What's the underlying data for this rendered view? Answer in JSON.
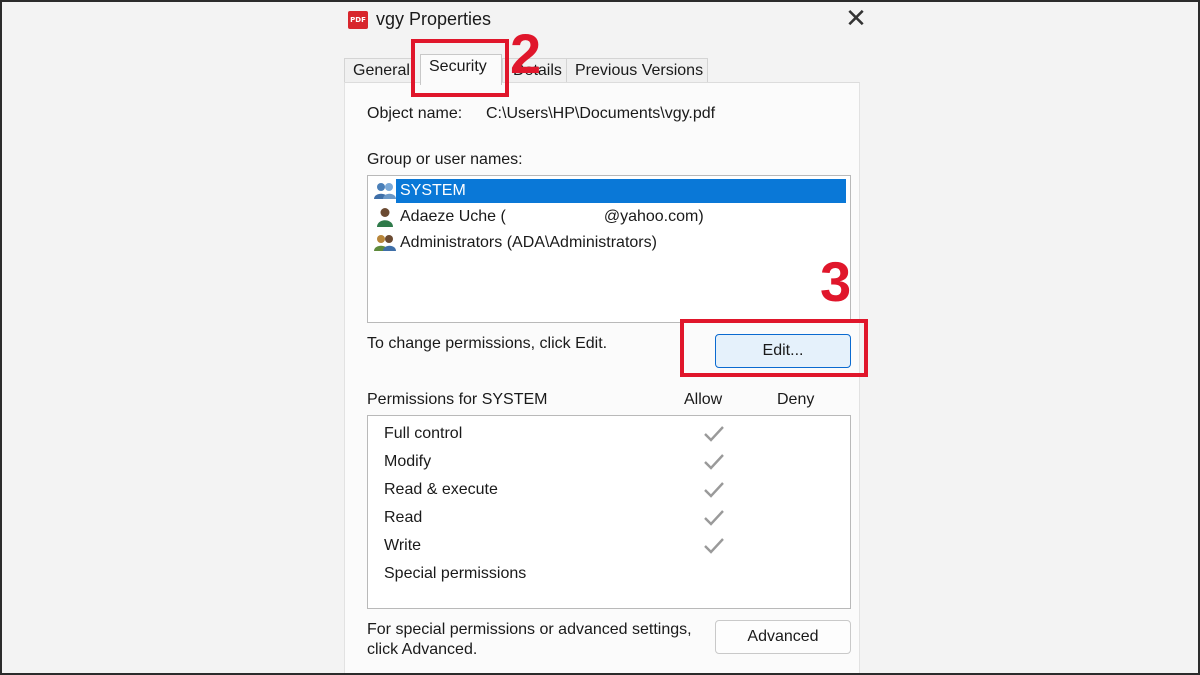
{
  "window": {
    "title": "vgy Properties",
    "app_icon_text": "PDF",
    "close_glyph": "✕"
  },
  "tabs": [
    {
      "label": "General",
      "active": false
    },
    {
      "label": "Security",
      "active": true
    },
    {
      "label": "Details",
      "active": false
    },
    {
      "label": "Previous Versions",
      "active": false
    }
  ],
  "security": {
    "object_name_label": "Object name:",
    "object_name_value": "C:\\Users\\HP\\Documents\\vgy.pdf",
    "group_label": "Group or user names:",
    "users": [
      {
        "name": "SYSTEM",
        "icon": "users-group-icon",
        "selected": true
      },
      {
        "name": "Adaeze Uche (",
        "email_suffix": "@yahoo.com)",
        "icon": "user-icon",
        "selected": false
      },
      {
        "name": "Administrators (ADA\\Administrators)",
        "icon": "users-group-icon",
        "selected": false
      }
    ],
    "change_hint": "To change permissions, click Edit.",
    "edit_button": "Edit...",
    "permissions_label": "Permissions for SYSTEM",
    "allow_header": "Allow",
    "deny_header": "Deny",
    "permissions": [
      {
        "name": "Full control",
        "allow": true,
        "deny": false
      },
      {
        "name": "Modify",
        "allow": true,
        "deny": false
      },
      {
        "name": "Read & execute",
        "allow": true,
        "deny": false
      },
      {
        "name": "Read",
        "allow": true,
        "deny": false
      },
      {
        "name": "Write",
        "allow": true,
        "deny": false
      },
      {
        "name": "Special permissions",
        "allow": false,
        "deny": false
      }
    ],
    "advanced_hint_line1": "For special permissions or advanced settings,",
    "advanced_hint_line2": "click Advanced.",
    "advanced_button": "Advanced"
  },
  "annotations": {
    "step_security": "2",
    "step_edit": "3",
    "highlight_color": "#e0162b"
  },
  "colors": {
    "selection": "#0a78d7",
    "edit_button_border": "#0a6ad0",
    "check_color": "#9a9a9a"
  }
}
